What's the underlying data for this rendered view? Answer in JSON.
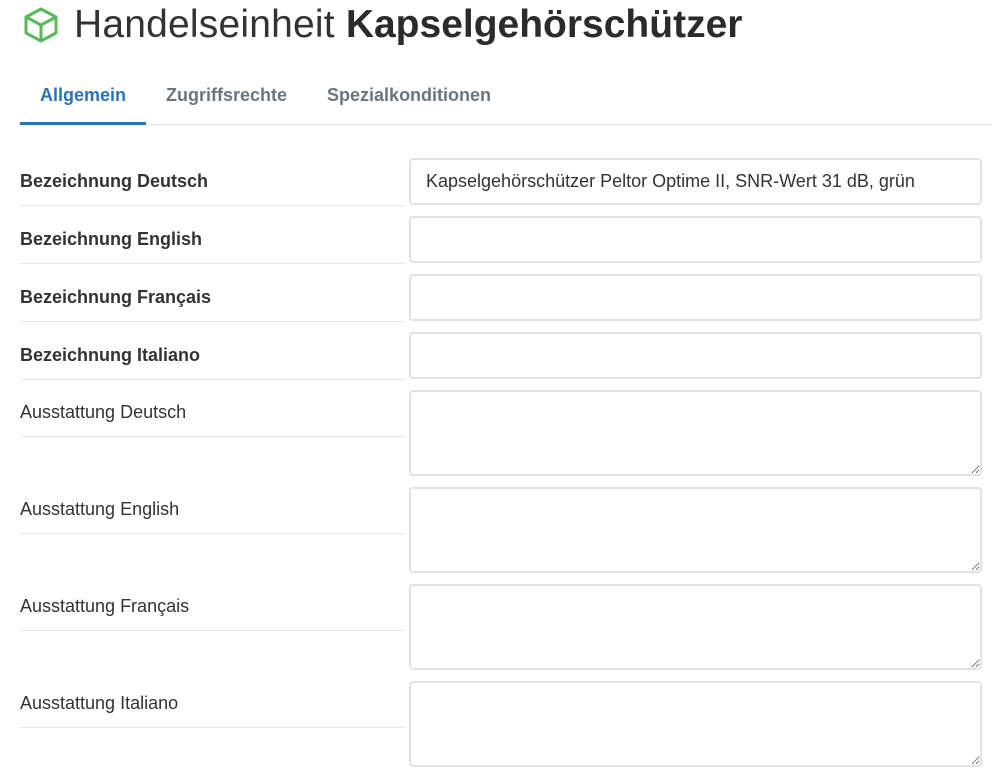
{
  "header": {
    "icon": "cube-icon",
    "icon_color": "#5cb85c",
    "title_prefix": "Handelseinheit",
    "title_main": "Kapselgehörschützer"
  },
  "tabs": [
    {
      "label": "Allgemein",
      "active": true
    },
    {
      "label": "Zugriffsrechte",
      "active": false
    },
    {
      "label": "Spezialkonditionen",
      "active": false
    }
  ],
  "accent_color": "#2e73b8",
  "form": {
    "fields": [
      {
        "label": "Bezeichnung Deutsch",
        "value": "Kapselgehörschützer Peltor Optime II, SNR-Wert 31 dB, grün",
        "type": "input"
      },
      {
        "label": "Bezeichnung English",
        "value": "",
        "type": "input"
      },
      {
        "label": "Bezeichnung Français",
        "value": "",
        "type": "input"
      },
      {
        "label": "Bezeichnung Italiano",
        "value": "",
        "type": "input"
      },
      {
        "label": "Ausstattung Deutsch",
        "value": "",
        "type": "textarea"
      },
      {
        "label": "Ausstattung English",
        "value": "",
        "type": "textarea"
      },
      {
        "label": "Ausstattung Français",
        "value": "",
        "type": "textarea"
      },
      {
        "label": "Ausstattung Italiano",
        "value": "",
        "type": "textarea"
      }
    ]
  }
}
